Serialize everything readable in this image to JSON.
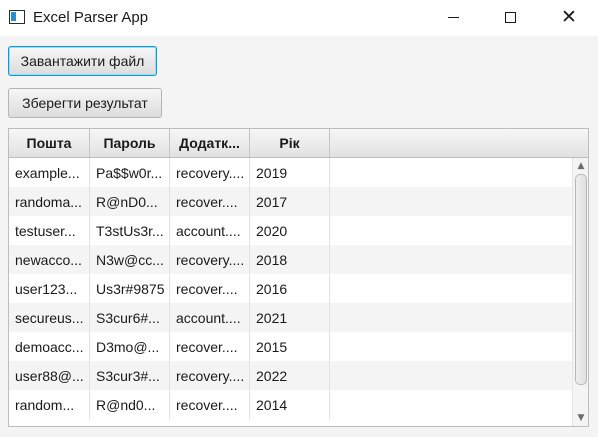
{
  "window": {
    "title": "Excel Parser App",
    "controls": {
      "minimize": "minimize",
      "maximize": "maximize",
      "close": "close"
    }
  },
  "toolbar": {
    "load_label": "Завантажити файл",
    "save_label": "Зберегти результат"
  },
  "table": {
    "columns": [
      "Пошта",
      "Пароль",
      "Додатк...",
      "Рік"
    ],
    "rows": [
      [
        "example...",
        "Pa$$w0r...",
        "recovery....",
        "2019"
      ],
      [
        "randoma...",
        "R@nD0...",
        "recover....",
        "2017"
      ],
      [
        "testuser...",
        "T3stUs3r...",
        "account....",
        "2020"
      ],
      [
        "newacco...",
        "N3w@cc...",
        "recovery....",
        "2018"
      ],
      [
        "user123...",
        "Us3r#9875",
        "recover....",
        "2016"
      ],
      [
        "secureus...",
        "S3cur6#...",
        "account....",
        "2021"
      ],
      [
        "demoacc...",
        "D3mo@...",
        "recover....",
        "2015"
      ],
      [
        "user88@...",
        "S3cur3#...",
        "recovery....",
        "2022"
      ],
      [
        "random...",
        "R@nd0...",
        "recover....",
        "2014"
      ]
    ]
  },
  "scrollbar": {
    "up_icon": "chevron-up-icon",
    "down_icon": "chevron-down-icon"
  },
  "colors": {
    "focus_border": "#039ed3",
    "row_alt": "#f4f4f4",
    "background": "#f4f4f4"
  }
}
